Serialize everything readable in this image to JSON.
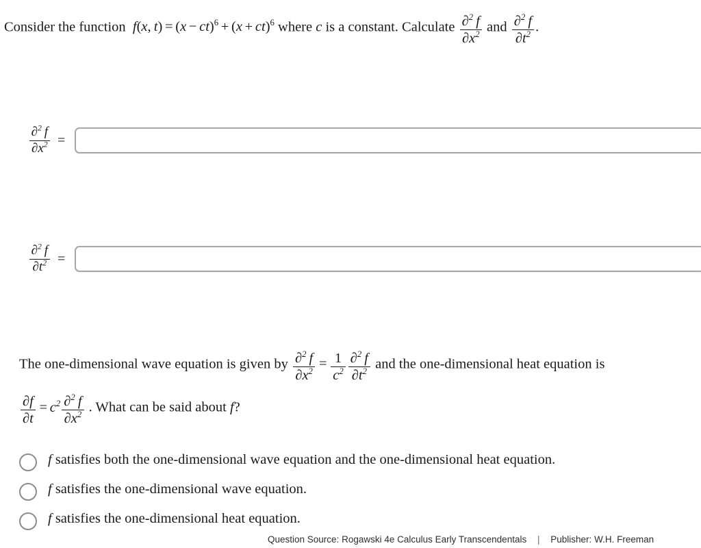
{
  "question": {
    "intro": "Consider the function",
    "function_expr": "f(x, t) = (x − ct)⁶ + (x + ct)⁶",
    "middle": "where",
    "constant_symbol": "c",
    "constant_phrase": "is a constant. Calculate",
    "derivative_1": "∂²f/∂x²",
    "conjunction": "and",
    "derivative_2": "∂²f/∂t²",
    "terminator": "."
  },
  "answers": [
    {
      "label_numerator": "∂²f",
      "label_denominator": "∂x²",
      "equals": "=",
      "value": "",
      "placeholder": ""
    },
    {
      "label_numerator": "∂²f",
      "label_denominator": "∂t²",
      "equals": "=",
      "value": "",
      "placeholder": ""
    }
  ],
  "followup": {
    "line1_prefix": "The one-dimensional wave equation is given by",
    "wave_equation": "∂²f/∂x² = (1/c²) ∂²f/∂t²",
    "line1_suffix": "and the one-dimensional heat equation is",
    "heat_equation": "∂f/∂t = c² ∂²f/∂x²",
    "line2_suffix": ". What can be said about",
    "variable": "f",
    "question_mark": "?"
  },
  "options": [
    {
      "id": "option-both",
      "text_prefix": "f",
      "text": "satisfies both the one-dimensional wave equation and the one-dimensional heat equation.",
      "selected": false
    },
    {
      "id": "option-wave",
      "text_prefix": "f",
      "text": "satisfies the one-dimensional wave equation.",
      "selected": false
    },
    {
      "id": "option-heat",
      "text_prefix": "f",
      "text": "satisfies the one-dimensional heat equation.",
      "selected": false
    }
  ],
  "footer": {
    "source_label": "Question Source:",
    "source_value": "Rogawski 4e Calculus Early Transcendentals",
    "separator": "|",
    "publisher_label": "Publisher:",
    "publisher_value": "W.H. Freeman"
  },
  "colors": {
    "text": "#1a1a1a",
    "input_border": "#a8a8a8",
    "radio_border": "#8c8c8c",
    "footer_text": "#2e2e2e",
    "background": "#ffffff"
  }
}
